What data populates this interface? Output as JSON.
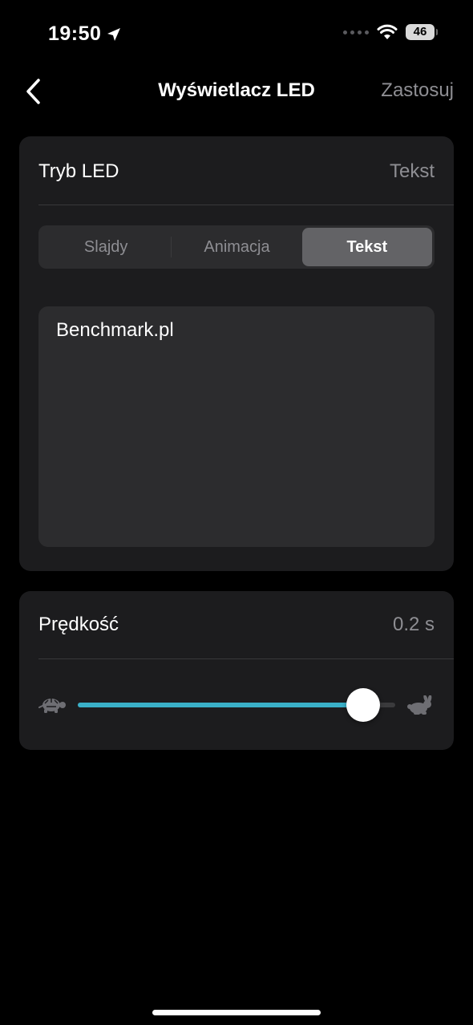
{
  "status_bar": {
    "time": "19:50",
    "battery": "46"
  },
  "nav": {
    "title": "Wyświetlacz LED",
    "apply_label": "Zastosuj"
  },
  "led_mode": {
    "label": "Tryb LED",
    "value": "Tekst",
    "segments": [
      {
        "label": "Slajdy",
        "selected": false
      },
      {
        "label": "Animacja",
        "selected": false
      },
      {
        "label": "Tekst",
        "selected": true
      }
    ],
    "text_value": "Benchmark.pl"
  },
  "speed": {
    "label": "Prędkość",
    "value": "0.2 s",
    "slider_fraction": 0.9,
    "accent_color": "#3ab0c8"
  },
  "icons": {
    "back": "chevron-left-icon",
    "location": "location-arrow-icon",
    "wifi": "wifi-icon",
    "slow": "turtle-icon",
    "fast": "rabbit-icon"
  }
}
